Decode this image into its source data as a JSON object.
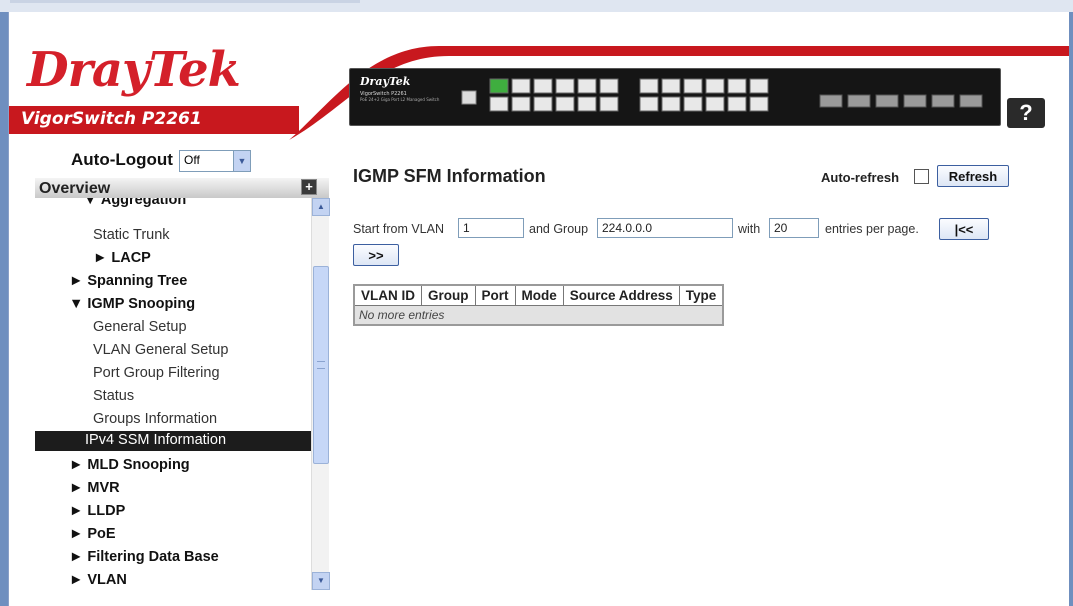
{
  "header": {
    "brand": "DrayTek",
    "model": "VigorSwitch P2261",
    "device_brand": "DrayTek",
    "device_model": "VigorSwitch P2261",
    "device_desc": "PoE 24+2 Giga Port L2 Managed Switch",
    "help_label": "?",
    "colors": {
      "brand_red": "#d4202a",
      "model_bar": "#c8181e"
    }
  },
  "sidebar": {
    "auto_logout_label": "Auto-Logout",
    "auto_logout_value": "Off",
    "overview_label": "Overview",
    "items": [
      {
        "label": "▼ Aggregation",
        "bold": true
      },
      {
        "label": "Static Trunk"
      },
      {
        "label": "► LACP",
        "bold": true
      },
      {
        "label": "► Spanning Tree",
        "bold": true
      },
      {
        "label": "▼ IGMP Snooping",
        "bold": true
      },
      {
        "label": "General Setup"
      },
      {
        "label": "VLAN General Setup"
      },
      {
        "label": "Port Group Filtering"
      },
      {
        "label": "Status"
      },
      {
        "label": "Groups Information"
      },
      {
        "label": "IPv4 SSM Information",
        "selected": true
      },
      {
        "label": "► MLD Snooping",
        "bold": true
      },
      {
        "label": "► MVR",
        "bold": true
      },
      {
        "label": "► LLDP",
        "bold": true
      },
      {
        "label": "► PoE",
        "bold": true
      },
      {
        "label": "► Filtering Data Base",
        "bold": true
      },
      {
        "label": "► VLAN",
        "bold": true
      }
    ]
  },
  "main": {
    "title": "IGMP SFM Information",
    "auto_refresh_label": "Auto-refresh",
    "refresh_label": "Refresh",
    "start_vlan_label": "Start from VLAN",
    "start_vlan_value": "1",
    "group_label": "and Group",
    "group_value": "224.0.0.0",
    "with_label": "with",
    "entries_value": "20",
    "entries_label": "entries per page.",
    "first_page_label": "|<<",
    "next_page_label": ">>",
    "table": {
      "columns": [
        "VLAN ID",
        "Group",
        "Port",
        "Mode",
        "Source Address",
        "Type"
      ],
      "empty_message": "No more entries"
    }
  }
}
